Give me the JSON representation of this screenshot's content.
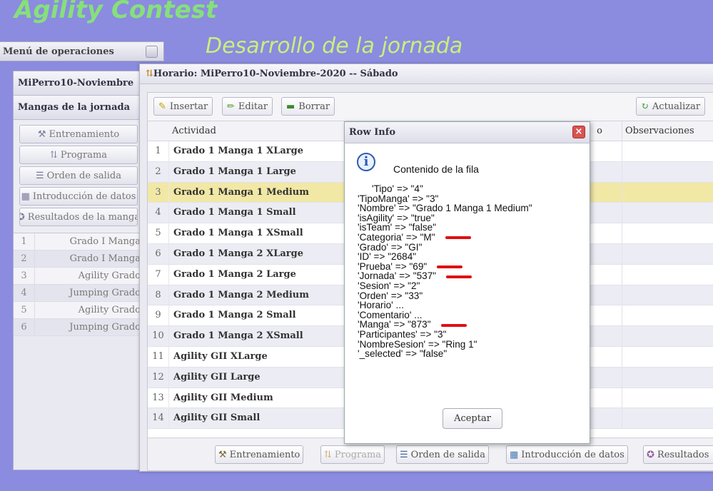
{
  "app": {
    "title": "Agility Contest",
    "page_title": "Desarrollo de la jornada"
  },
  "ops_menu": {
    "label": "Menú de operaciones"
  },
  "left_panel": {
    "header": "MiPerro10-Noviembre",
    "section": "Mangas de la jornada",
    "buttons": [
      {
        "icon": "⚒",
        "label": "Entrenamiento"
      },
      {
        "icon": "⇅",
        "label": "Programa"
      },
      {
        "icon": "☰",
        "label": "Orden de salida"
      },
      {
        "icon": "▦",
        "label": "Introducción de datos"
      },
      {
        "icon": "✪",
        "label": "Resultados de la manga"
      }
    ],
    "rows": [
      {
        "num": "1",
        "text": "Grado I Manga"
      },
      {
        "num": "2",
        "text": "Grado I Manga"
      },
      {
        "num": "3",
        "text": "Agility Grado"
      },
      {
        "num": "4",
        "text": "Jumping Grado"
      },
      {
        "num": "5",
        "text": "Agility Grado"
      },
      {
        "num": "6",
        "text": "Jumping Grado"
      }
    ]
  },
  "main_window": {
    "title": "Horario: MiPerro10-Noviembre-2020 -- Sábado",
    "toolbar": {
      "insert": "Insertar",
      "edit": "Editar",
      "delete": "Borrar",
      "refresh": "Actualizar"
    },
    "columns": {
      "activity": "Actividad",
      "hidden_col_tail": "o",
      "observations": "Observaciones"
    },
    "rows": [
      {
        "num": "1",
        "activity": "Grado 1 Manga 1 XLarge"
      },
      {
        "num": "2",
        "activity": "Grado 1 Manga 1 Large"
      },
      {
        "num": "3",
        "activity": "Grado 1 Manga 1 Medium",
        "selected": true
      },
      {
        "num": "4",
        "activity": "Grado 1 Manga 1 Small"
      },
      {
        "num": "5",
        "activity": "Grado 1 Manga 1 XSmall"
      },
      {
        "num": "6",
        "activity": "Grado 1 Manga 2 XLarge"
      },
      {
        "num": "7",
        "activity": "Grado 1 Manga 2 Large"
      },
      {
        "num": "8",
        "activity": "Grado 1 Manga 2 Medium"
      },
      {
        "num": "9",
        "activity": "Grado 1 Manga 2 Small"
      },
      {
        "num": "10",
        "activity": "Grado 1 Manga 2 XSmall"
      },
      {
        "num": "11",
        "activity": "Agility GII XLarge"
      },
      {
        "num": "12",
        "activity": "Agility GII Large"
      },
      {
        "num": "13",
        "activity": "Agility GII Medium"
      },
      {
        "num": "14",
        "activity": "Agility GII Small"
      }
    ],
    "bottom_buttons": {
      "training": "Entrenamiento",
      "program": "Programa",
      "order": "Orden de salida",
      "data_entry": "Introducción de datos",
      "results": "Resultados"
    }
  },
  "dialog": {
    "title": "Row Info",
    "heading": "Contenido de la fila",
    "lines": [
      "'Tipo' => \"4\"",
      "'TipoManga' => \"3\"",
      "'Nombre' => \"Grado 1 Manga 1 Medium\"",
      "'isAgility' => \"true\"",
      "'isTeam' => \"false\"",
      "'Categoria' => \"M\"",
      "'Grado' => \"GI\"",
      "'ID' => \"2684\"",
      "'Prueba' => \"69\"",
      "'Jornada' => \"537\"",
      "'Sesion' => \"2\"",
      "'Orden' => \"33\"",
      "'Horario' ...",
      "'Comentario' ...",
      "'Manga' => \"873\"",
      "'Participantes' => \"3\"",
      "'NombreSesion' => \"Ring 1\"",
      "'_selected' => \"false\""
    ],
    "ok_button": "Aceptar"
  }
}
